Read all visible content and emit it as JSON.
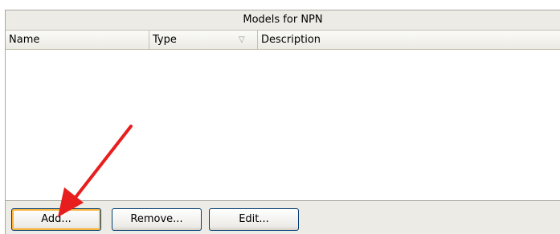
{
  "panel": {
    "title": "Models for NPN"
  },
  "columns": {
    "name": "Name",
    "type": "Type",
    "description": "Description",
    "sort_glyph": "▽"
  },
  "buttons": {
    "add_label": "Add...",
    "remove_label": "Remove...",
    "edit_label": "Edit..."
  },
  "annotation": {
    "arrow_color": "#e81e1e"
  }
}
